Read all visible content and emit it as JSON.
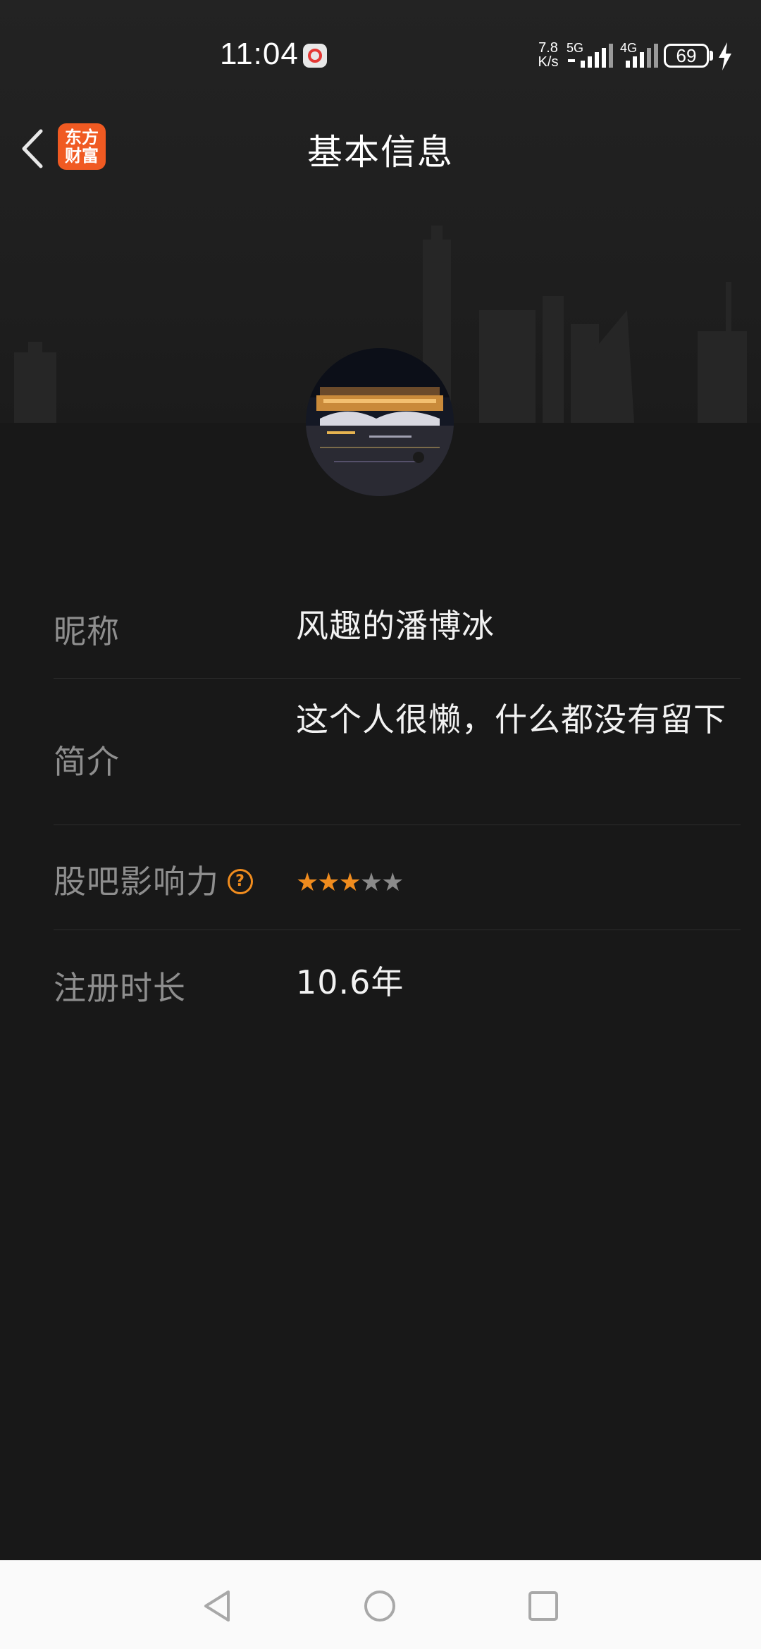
{
  "status_bar": {
    "time": "11:04",
    "net_speed_value": "7.8",
    "net_speed_unit": "K/s",
    "signal_1_label": "5G",
    "signal_2_label": "4G",
    "battery": "69"
  },
  "nav": {
    "title": "基本信息",
    "logo_line1": "东方",
    "logo_line2": "财富"
  },
  "profile": {
    "rows": [
      {
        "label": "昵称",
        "value": "风趣的潘博冰"
      },
      {
        "label": "简介",
        "value": "这个人很懒，什么都没有留下"
      },
      {
        "label": "股吧影响力",
        "help_icon": "question-icon",
        "rating": 3,
        "rating_max": 5
      },
      {
        "label": "注册时长",
        "value": "10.6年"
      }
    ]
  },
  "colors": {
    "background": "#181818",
    "accent": "#f08c1e",
    "brand": "#f05a22",
    "label_text": "#8e8e8e",
    "value_text": "#f2f2f2"
  }
}
